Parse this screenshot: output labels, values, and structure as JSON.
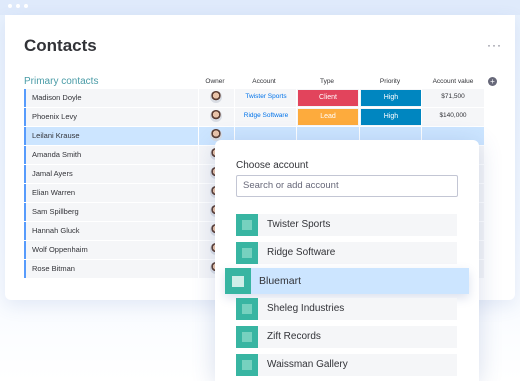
{
  "board": {
    "title": "Contacts",
    "more_label": "···",
    "group_title": "Primary contacts",
    "columns": [
      "Owner",
      "Account",
      "Type",
      "Priority",
      "Account value"
    ],
    "add_column_label": "+"
  },
  "rows": [
    {
      "name": "Madison Doyle",
      "account": "Twister Sports",
      "type": "Client",
      "type_color": "#e2445c",
      "priority": "High",
      "priority_color": "#0086c0",
      "value": "$71,500"
    },
    {
      "name": "Phoenix Levy",
      "account": "Ridge Software",
      "type": "Lead",
      "type_color": "#fdab3d",
      "priority": "High",
      "priority_color": "#0086c0",
      "value": "$140,000"
    },
    {
      "name": "Leilani Krause",
      "account": "",
      "type": "",
      "priority": "",
      "value": ""
    },
    {
      "name": "Amanda Smith",
      "account": "",
      "type": "",
      "priority": "",
      "value": ""
    },
    {
      "name": "Jamal Ayers",
      "account": "",
      "type": "",
      "priority": "",
      "value": ""
    },
    {
      "name": "Elian Warren",
      "account": "",
      "type": "",
      "priority": "",
      "value": ""
    },
    {
      "name": "Sam Spillberg",
      "account": "",
      "type": "",
      "priority": "",
      "value": ""
    },
    {
      "name": "Hannah Gluck",
      "account": "",
      "type": "",
      "priority": "",
      "value": ""
    },
    {
      "name": "Wolf Oppenhaim",
      "account": "",
      "type": "",
      "priority": "",
      "value": ""
    },
    {
      "name": "Rose Bitman",
      "account": "",
      "type": "",
      "priority": "",
      "value": ""
    }
  ],
  "dropdown": {
    "title": "Choose account",
    "search_placeholder": "Search or add account",
    "options": [
      "Twister Sports",
      "Ridge Software",
      "Bluemart",
      "Sheleg Industries",
      "Zift Records",
      "Waissman Gallery"
    ],
    "highlighted": "Bluemart"
  },
  "colors": {
    "accent": "#579bfc",
    "group": "#4a9ca7",
    "account_swatch": "#38b5a2",
    "selected_row": "#cce5ff"
  }
}
